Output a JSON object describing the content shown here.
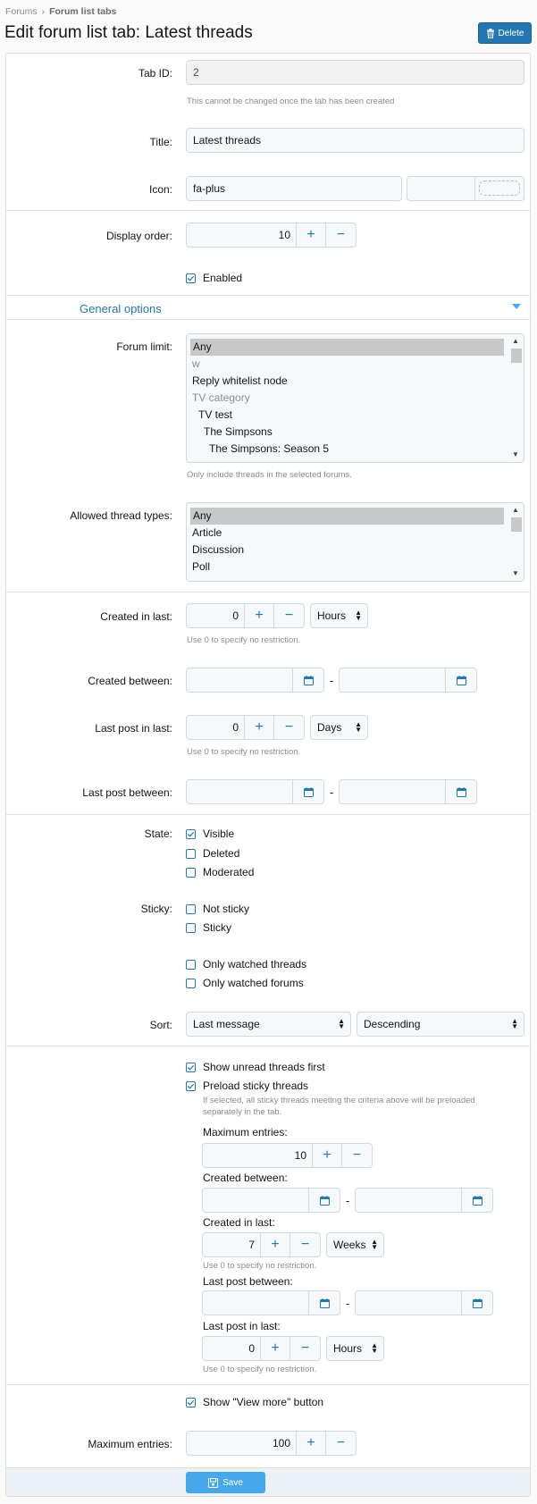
{
  "breadcrumb": {
    "items": [
      "Forums",
      "Forum list tabs"
    ]
  },
  "page": {
    "title": "Edit forum list tab: Latest threads",
    "delete_label": "Delete",
    "save_label": "Save"
  },
  "form": {
    "tab_id": {
      "label": "Tab ID:",
      "value": "2",
      "hint": "This cannot be changed once the tab has been created"
    },
    "title": {
      "label": "Title:",
      "value": "Latest threads"
    },
    "icon": {
      "label": "Icon:",
      "value": "fa-plus"
    },
    "display_order": {
      "label": "Display order:",
      "value": "10"
    },
    "enabled": {
      "label": "Enabled",
      "checked": true
    }
  },
  "section": {
    "title": "General options"
  },
  "forum_limit": {
    "label": "Forum limit:",
    "options": [
      {
        "text": "Any",
        "selected": true,
        "grey": false,
        "indent": 0
      },
      {
        "text": "w",
        "selected": false,
        "grey": true,
        "indent": 0
      },
      {
        "text": "Reply whitelist node",
        "selected": false,
        "grey": false,
        "indent": 0
      },
      {
        "text": "TV category",
        "selected": false,
        "grey": true,
        "indent": 0
      },
      {
        "text": "TV test",
        "selected": false,
        "grey": false,
        "indent": 1
      },
      {
        "text": "The Simpsons",
        "selected": false,
        "grey": false,
        "indent": 2
      },
      {
        "text": "The Simpsons: Season 5",
        "selected": false,
        "grey": false,
        "indent": 3
      }
    ],
    "hint": "Only include threads in the selected forums."
  },
  "thread_types": {
    "label": "Allowed thread types:",
    "options": [
      {
        "text": "Any",
        "selected": true
      },
      {
        "text": "Article",
        "selected": false
      },
      {
        "text": "Discussion",
        "selected": false
      },
      {
        "text": "Poll",
        "selected": false
      }
    ]
  },
  "created_in_last": {
    "label": "Created in last:",
    "value": "0",
    "unit": "Hours",
    "hint": "Use 0 to specify no restriction."
  },
  "created_between": {
    "label": "Created between:",
    "separator": "-"
  },
  "last_post_in_last": {
    "label": "Last post in last:",
    "value": "0",
    "unit": "Days",
    "hint": "Use 0 to specify no restriction."
  },
  "last_post_between": {
    "label": "Last post between:",
    "separator": "-"
  },
  "state": {
    "label": "State:",
    "options": [
      {
        "text": "Visible",
        "checked": true
      },
      {
        "text": "Deleted",
        "checked": false
      },
      {
        "text": "Moderated",
        "checked": false
      }
    ]
  },
  "sticky": {
    "label": "Sticky:",
    "options": [
      {
        "text": "Not sticky",
        "checked": false
      },
      {
        "text": "Sticky",
        "checked": false
      }
    ]
  },
  "watched": {
    "options": [
      {
        "text": "Only watched threads",
        "checked": false
      },
      {
        "text": "Only watched forums",
        "checked": false
      }
    ]
  },
  "sort": {
    "label": "Sort:",
    "field": "Last message",
    "direction": "Descending"
  },
  "unread_first": {
    "text": "Show unread threads first",
    "checked": true
  },
  "preload": {
    "text": "Preload sticky threads",
    "checked": true,
    "hint_line1": "If selected, all sticky threads meeting the criteria above will be preloaded",
    "hint_line2": "separately in the tab.",
    "max_entries": {
      "label": "Maximum entries:",
      "value": "10"
    },
    "created_between": {
      "label": "Created between:",
      "separator": "-"
    },
    "created_in_last": {
      "label": "Created in last:",
      "value": "7",
      "unit": "Weeks",
      "hint": "Use 0 to specify no restriction."
    },
    "last_post_between": {
      "label": "Last post between:",
      "separator": "-"
    },
    "last_post_in_last": {
      "label": "Last post in last:",
      "value": "0",
      "unit": "Hours",
      "hint": "Use 0 to specify no restriction."
    }
  },
  "view_more": {
    "text": "Show \"View more\" button",
    "checked": true
  },
  "max_entries": {
    "label": "Maximum entries:",
    "value": "100"
  },
  "icons": {
    "plus": "+",
    "minus": "−",
    "select_arrow": "▲▼"
  },
  "colors": {
    "accent": "#2577b1",
    "save": "#47a7eb",
    "panel_bg": "#ffffff",
    "input_bg": "#f5f9fc"
  }
}
